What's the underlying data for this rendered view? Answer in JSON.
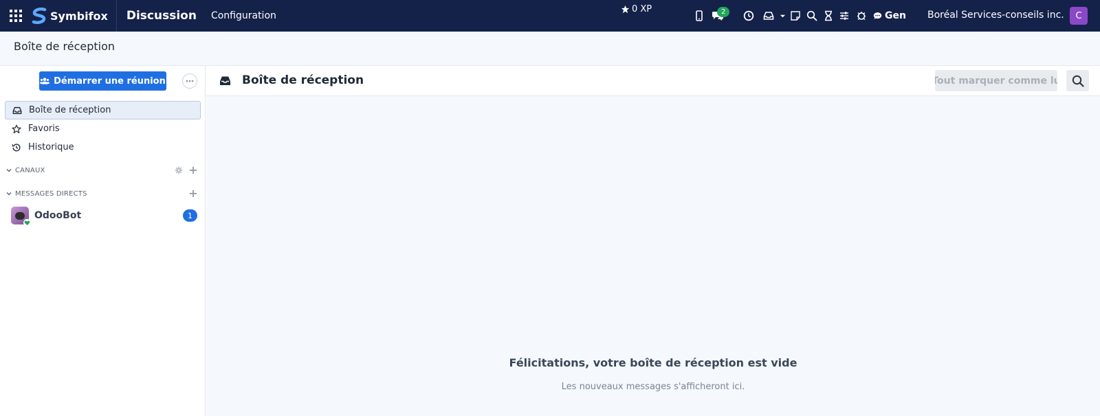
{
  "topbar": {
    "brand": "Symbifox",
    "app_name": "Discussion",
    "menu_configuration": "Configuration",
    "xp": "0 XP",
    "chat_badge": "2",
    "gen": "Gen",
    "company": "Boréal Services-conseils inc.",
    "avatar_letter": "C"
  },
  "breadcrumb": "Boîte de réception",
  "sidebar": {
    "start_meeting": "Démarrer une réunion",
    "items": [
      {
        "label": "Boîte de réception",
        "icon": "inbox-icon",
        "active": true
      },
      {
        "label": "Favoris",
        "icon": "star-icon",
        "active": false
      },
      {
        "label": "Historique",
        "icon": "history-icon",
        "active": false
      }
    ],
    "channels_header": "CANAUX",
    "direct_messages_header": "MESSAGES DIRECTS",
    "direct_messages": [
      {
        "name": "OdooBot",
        "unread": "1"
      }
    ]
  },
  "main": {
    "title": "Boîte de réception",
    "mark_all_read": "Tout marquer comme lu",
    "empty_title": "Félicitations, votre boîte de réception est vide",
    "empty_subtitle": "Les nouveaux messages s'afficheront ici."
  },
  "colors": {
    "navbar": "#14224a",
    "primary": "#1f6fe2",
    "online": "#22a55b",
    "avatar": "#8b48c6"
  }
}
